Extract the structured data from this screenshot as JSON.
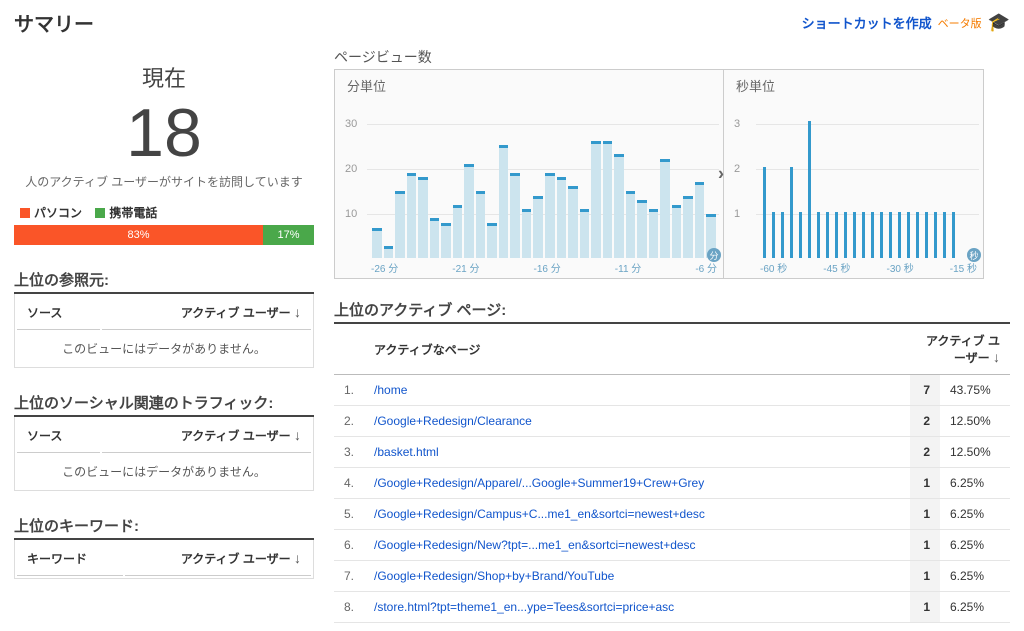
{
  "header": {
    "title": "サマリー",
    "shortcut_link": "ショートカットを作成",
    "beta_label": "ベータ版"
  },
  "now": {
    "label": "現在",
    "value": "18",
    "subtext": "人のアクティブ ユーザーがサイトを訪問しています"
  },
  "device_split": {
    "legend": [
      {
        "label": "パソコン",
        "color": "#fa5528"
      },
      {
        "label": "携帯電話",
        "color": "#4aa84a"
      }
    ],
    "segments": [
      {
        "pct": "83%",
        "width": 83,
        "class": "seg-pc"
      },
      {
        "pct": "17%",
        "width": 17,
        "class": "seg-mob"
      }
    ]
  },
  "mini_panels": {
    "referrers": {
      "title": "上位の参照元:",
      "col_source": "ソース",
      "col_users": "アクティブ ユーザー",
      "no_data": "このビューにはデータがありません。"
    },
    "social": {
      "title": "上位のソーシャル関連のトラフィック:",
      "col_source": "ソース",
      "col_users": "アクティブ ユーザー",
      "no_data": "このビューにはデータがありません。"
    },
    "keywords": {
      "title": "上位のキーワード:",
      "col_source": "キーワード",
      "col_users": "アクティブ ユーザー"
    }
  },
  "pageviews": {
    "title": "ページビュー数",
    "per_minute_label": "分単位",
    "per_second_label": "秒単位"
  },
  "chart_data": [
    {
      "type": "bar",
      "title": "ページビュー数 — 分単位",
      "xlabel": "分",
      "ylabel": "ページビュー数",
      "ylim": [
        0,
        35
      ],
      "categories": [
        "-30",
        "-29",
        "-28",
        "-27",
        "-26",
        "-25",
        "-24",
        "-23",
        "-22",
        "-21",
        "-20",
        "-19",
        "-18",
        "-17",
        "-16",
        "-15",
        "-14",
        "-13",
        "-12",
        "-11",
        "-10",
        "-9",
        "-8",
        "-7",
        "-6",
        "-5",
        "-4",
        "-3",
        "-2",
        "-1"
      ],
      "values": [
        6,
        2,
        14,
        18,
        17,
        8,
        7,
        11,
        20,
        14,
        7,
        24,
        18,
        10,
        13,
        18,
        17,
        15,
        10,
        25,
        25,
        22,
        14,
        12,
        10,
        21,
        11,
        13,
        16,
        9
      ],
      "x_tick_labels": [
        "-26 分",
        "-21 分",
        "-16 分",
        "-11 分",
        "-6 分"
      ],
      "unit_bubble": "分"
    },
    {
      "type": "bar",
      "title": "ページビュー数 — 秒単位",
      "xlabel": "秒",
      "ylabel": "ページビュー数",
      "ylim": [
        0,
        3.5
      ],
      "categories": [
        "-60",
        "-57",
        "-55",
        "-52",
        "-50",
        "-48",
        "-46",
        "-45",
        "-42",
        "-40",
        "-38",
        "-35",
        "-33",
        "-30",
        "-25",
        "-22",
        "-18",
        "-15",
        "-12",
        "-8",
        "-5",
        "-2"
      ],
      "values": [
        2,
        1,
        1,
        2,
        1,
        3,
        1,
        1,
        1,
        1,
        1,
        1,
        1,
        1,
        1,
        1,
        1,
        1,
        1,
        1,
        1,
        1
      ],
      "x_tick_labels": [
        "-60 秒",
        "-45 秒",
        "-30 秒",
        "-15 秒"
      ],
      "unit_bubble": "秒"
    }
  ],
  "active_pages": {
    "title": "上位のアクティブ ページ:",
    "col_page": "アクティブなページ",
    "col_users": "アクティブ ユーザー",
    "rows": [
      {
        "idx": "1.",
        "path": "/home",
        "count": "7",
        "pct": "43.75%"
      },
      {
        "idx": "2.",
        "path": "/Google+Redesign/Clearance",
        "count": "2",
        "pct": "12.50%"
      },
      {
        "idx": "3.",
        "path": "/basket.html",
        "count": "2",
        "pct": "12.50%"
      },
      {
        "idx": "4.",
        "path": "/Google+Redesign/Apparel/...Google+Summer19+Crew+Grey",
        "count": "1",
        "pct": "6.25%"
      },
      {
        "idx": "5.",
        "path": "/Google+Redesign/Campus+C...me1_en&sortci=newest+desc",
        "count": "1",
        "pct": "6.25%"
      },
      {
        "idx": "6.",
        "path": "/Google+Redesign/New?tpt=...me1_en&sortci=newest+desc",
        "count": "1",
        "pct": "6.25%"
      },
      {
        "idx": "7.",
        "path": "/Google+Redesign/Shop+by+Brand/YouTube",
        "count": "1",
        "pct": "6.25%"
      },
      {
        "idx": "8.",
        "path": "/store.html?tpt=theme1_en...ype=Tees&sortci=price+asc",
        "count": "1",
        "pct": "6.25%"
      }
    ]
  }
}
